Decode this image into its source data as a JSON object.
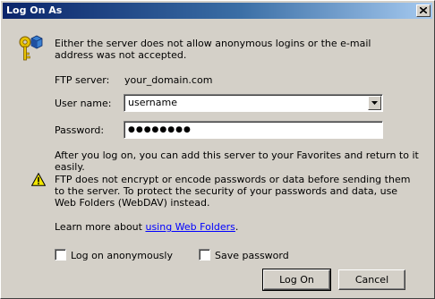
{
  "window": {
    "title": "Log On As"
  },
  "intro_text": "Either the server does not allow anonymous logins or the e-mail address was not accepted.",
  "form": {
    "ftp_server_label": "FTP server:",
    "ftp_server_value": "your_domain.com",
    "user_name_label": "User name:",
    "user_name_value": "username",
    "password_label": "Password:",
    "password_value": "●●●●●●●●"
  },
  "after_logon_text": "After you log on, you can add this server to your Favorites and return to it easily.",
  "warning_text": "FTP does not encrypt or encode passwords or data before sending them to the server.  To protect the security of your passwords and data, use Web Folders (WebDAV) instead.",
  "learn_more": {
    "prefix": "Learn more about ",
    "link_text": "using Web Folders",
    "suffix": "."
  },
  "options": {
    "anonymous_label": "Log on anonymously",
    "anonymous_checked": false,
    "save_password_label": "Save password",
    "save_password_checked": false
  },
  "buttons": {
    "log_on": "Log On",
    "cancel": "Cancel"
  },
  "icons": {
    "key": "key-icon",
    "warning": "warning-icon",
    "close": "close-icon",
    "dropdown": "chevron-down-icon"
  },
  "colors": {
    "title_bar_start": "#0a246a",
    "title_bar_end": "#a6caf0",
    "dialog_face": "#d4d0c8",
    "link": "#0000ff"
  }
}
